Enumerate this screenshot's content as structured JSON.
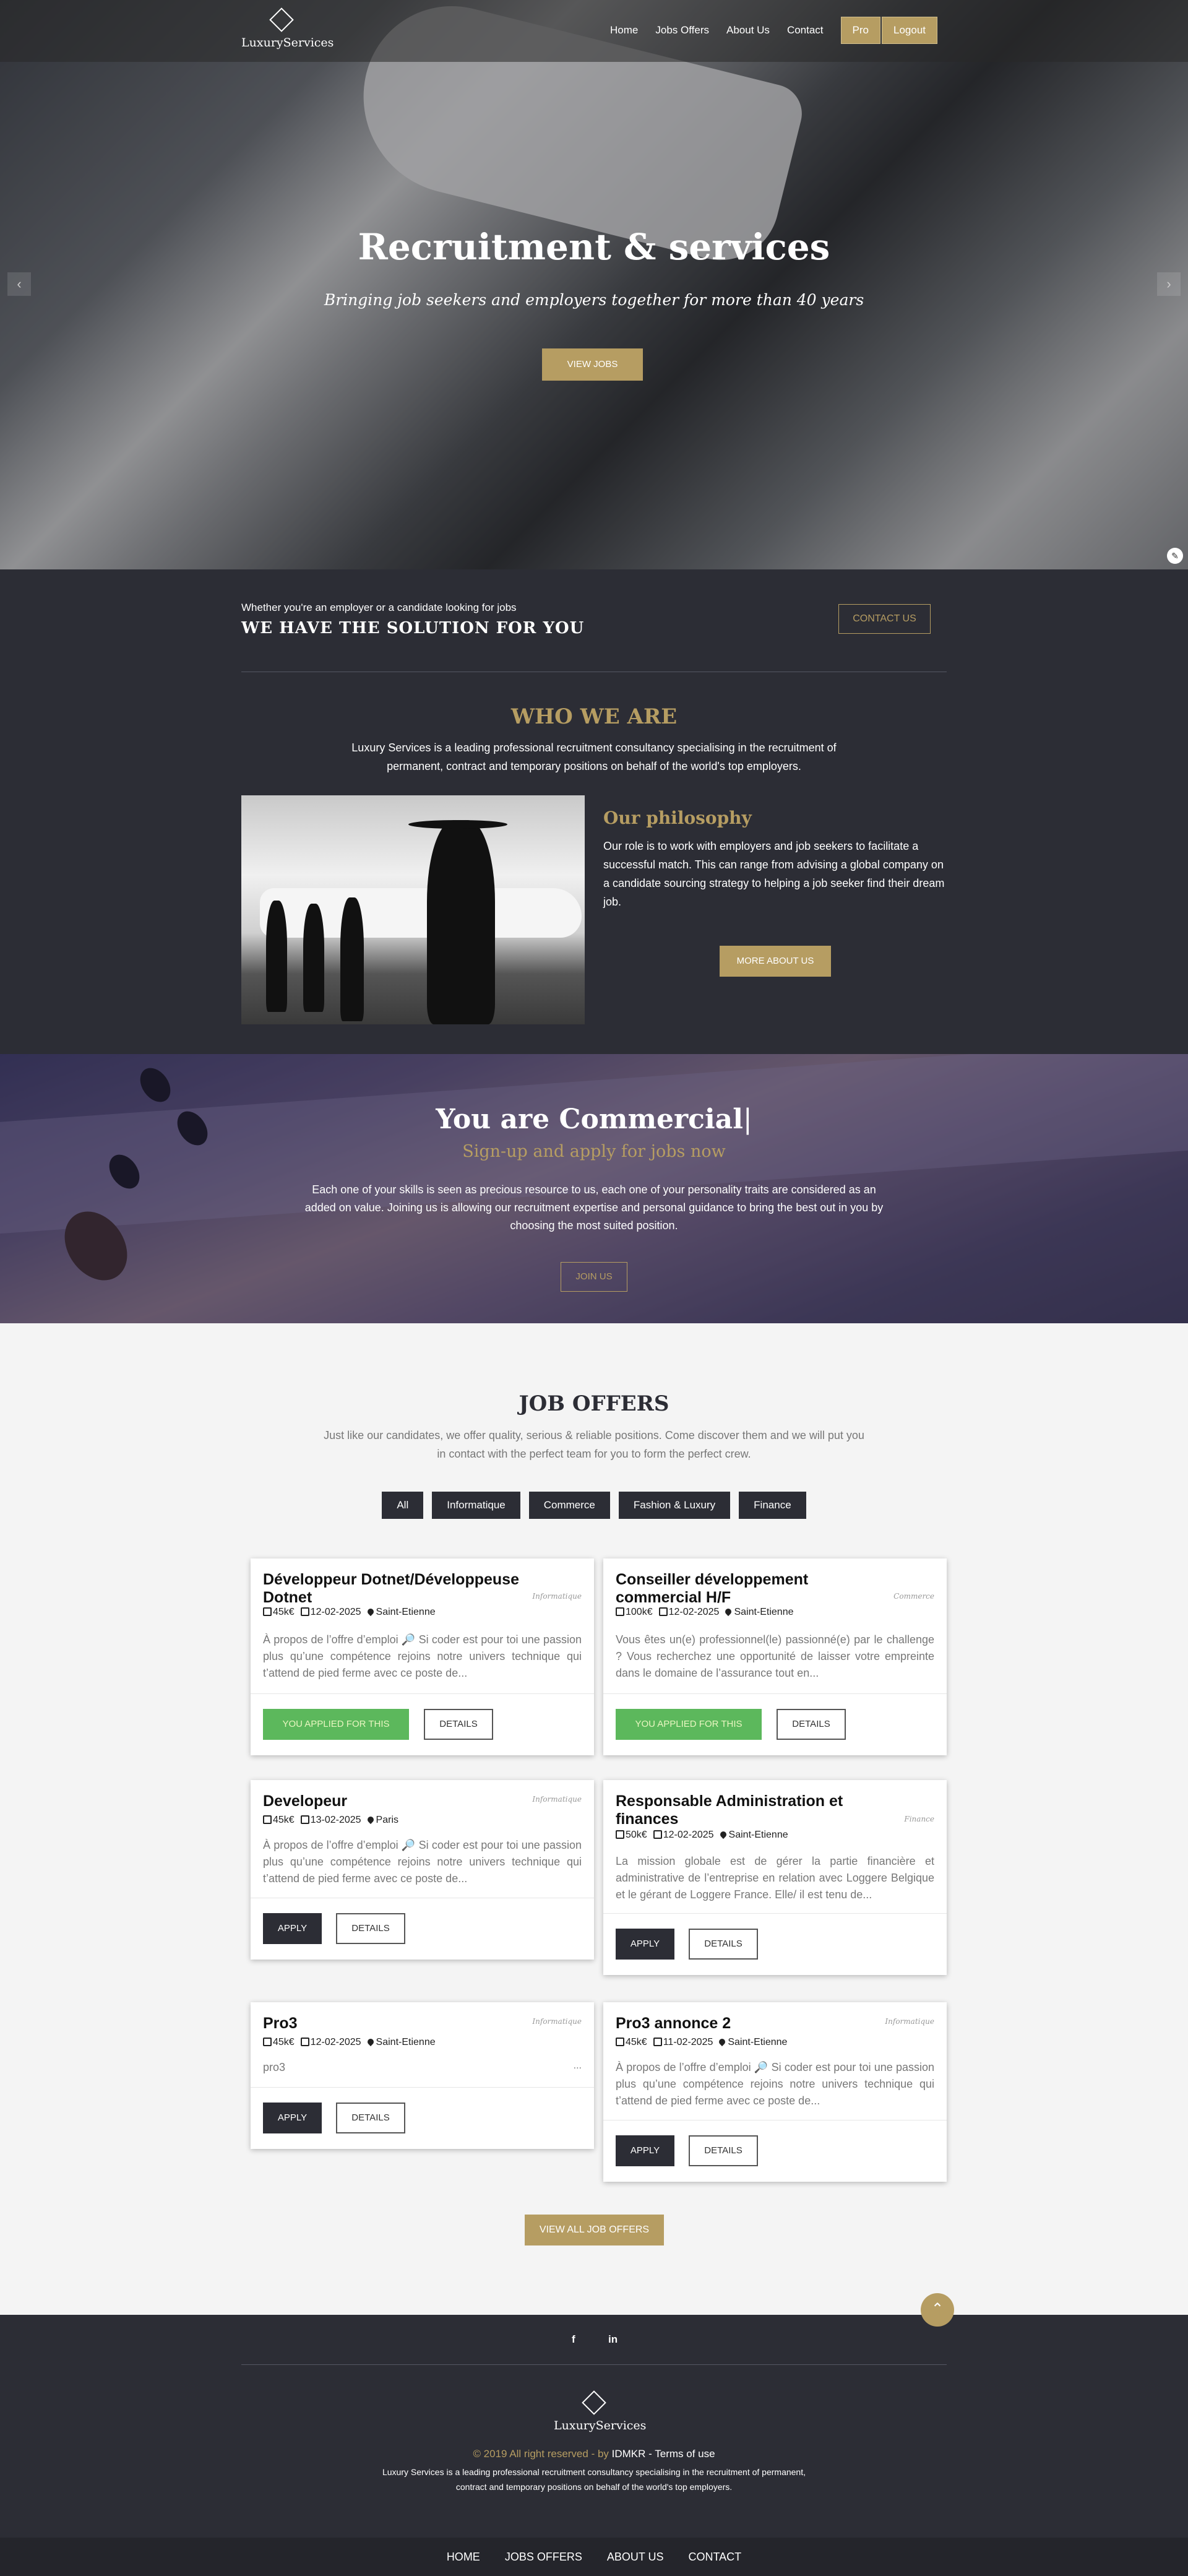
{
  "nav": {
    "logo_text": "LuxuryServices",
    "items": [
      "Home",
      "Jobs Offers",
      "About Us",
      "Contact"
    ],
    "pro": "Pro",
    "logout": "Logout"
  },
  "hero": {
    "title": "Recruitment & services",
    "subtitle": "Bringing job seekers and employers together for more than 40 years",
    "button": "VIEW JOBS",
    "prev": "‹",
    "next": "›"
  },
  "solution": {
    "small": "Whether you're an employer or a candidate looking for jobs",
    "big": "WE HAVE THE SOLUTION FOR YOU",
    "button": "CONTACT US"
  },
  "who": {
    "title": "WHO WE ARE",
    "text": "Luxury Services is a leading professional recruitment consultancy specialising in the recruitment of permanent, contract and temporary positions on behalf of the world's top employers.",
    "philosophy_title": "Our philosophy",
    "philosophy_text": "Our role is to work with employers and job seekers to facilitate a successful match. This can range from advising a global company on a candidate sourcing strategy to helping a job seeker find their dream job.",
    "button": "MORE ABOUT US"
  },
  "commercial": {
    "title_prefix": "You are",
    "title_word": "Commercial",
    "subtitle": "Sign-up and apply for jobs now",
    "text": "Each one of your skills is seen as precious resource to us, each one of your personality traits are considered as an added on value. Joining us is allowing our recruitment expertise and personal guidance to bring the best out in you by choosing the most suited position.",
    "button": "JOIN US"
  },
  "jobs": {
    "title": "JOB OFFERS",
    "intro": "Just like our candidates, we offer quality, serious & reliable positions. Come discover them and we will put you in contact with the perfect team for you to form the perfect crew.",
    "filters": [
      "All",
      "Informatique",
      "Commerce",
      "Fashion & Luxury",
      "Finance"
    ],
    "applied_label": "YOU APPLIED FOR THIS",
    "apply_label": "APPLY",
    "details_label": "DETAILS",
    "view_all": "VIEW ALL JOB OFFERS",
    "cards": [
      {
        "title": "Développeur Dotnet/Développeuse Dotnet",
        "category": "Informatique",
        "salary": "45k€",
        "date": "12-02-2025",
        "location": "Saint-Etienne",
        "desc": "À propos de l’offre d’emploi 🔎 Si coder est pour toi une passion plus qu’une compétence rejoins notre univers technique qui t’attend de pied ferme avec ce poste de...",
        "applied": true
      },
      {
        "title": "Conseiller développement commercial H/F",
        "category": "Commerce",
        "salary": "100k€",
        "date": "12-02-2025",
        "location": "Saint-Etienne",
        "desc": "Vous êtes un(e) professionnel(le) passionné(e) par le challenge ? Vous recherchez une opportunité de laisser votre empreinte dans le domaine de l’assurance tout en...",
        "applied": true
      },
      {
        "title": "Developeur",
        "category": "Informatique",
        "salary": "45k€",
        "date": "13-02-2025",
        "location": "Paris",
        "desc": "À propos de l’offre d’emploi 🔎 Si coder est pour toi une passion plus qu’une compétence rejoins notre univers technique qui t’attend de pied ferme avec ce poste de...",
        "applied": false
      },
      {
        "title": "Responsable Administration et finances",
        "category": "Finance",
        "salary": "50k€",
        "date": "12-02-2025",
        "location": "Saint-Etienne",
        "desc": "La mission globale est de gérer la partie financière et administrative de l’entreprise en relation avec Loggere Belgique et le gérant de Loggere France. Elle/ il est tenu de...",
        "applied": false
      },
      {
        "title": "Pro3",
        "category": "Informatique",
        "salary": "45k€",
        "date": "12-02-2025",
        "location": "Saint-Etienne",
        "desc": "pro3",
        "applied": false
      },
      {
        "title": "Pro3 annonce 2",
        "category": "Informatique",
        "salary": "45k€",
        "date": "11-02-2025",
        "location": "Saint-Etienne",
        "desc": "À propos de l’offre d’emploi 🔎 Si coder est pour toi une passion plus qu’une compétence rejoins notre univers technique qui t’attend de pied ferme avec ce poste de...",
        "applied": false
      }
    ]
  },
  "footer": {
    "social": [
      "f",
      "in"
    ],
    "logo_text": "LuxuryServices",
    "copyright": "© 2019 All right reserved - by",
    "company": "IDMKR",
    "separator": " - ",
    "terms": "Terms of use",
    "about": "Luxury Services is a leading professional recruitment consultancy specialising in the recruitment of permanent, contract and temporary positions on behalf of the world's top employers.",
    "links": [
      "HOME",
      "JOBS OFFERS",
      "ABOUT US",
      "CONTACT"
    ]
  },
  "colors": {
    "gold": "#b69d62",
    "dark": "#2c2d35",
    "applied_green": "#5cb85c"
  }
}
